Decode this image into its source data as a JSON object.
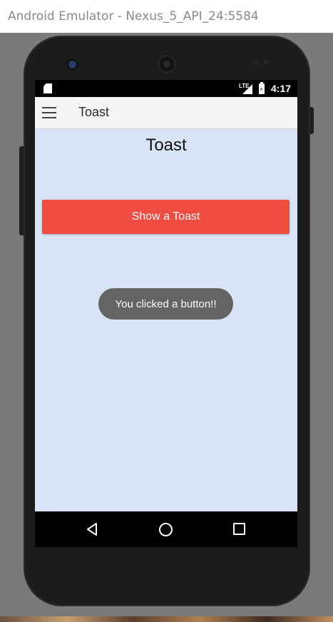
{
  "window": {
    "title": "Android Emulator - Nexus_5_API_24:5584"
  },
  "statusbar": {
    "network": "LTE",
    "time": "4:17"
  },
  "appbar": {
    "title": "Toast"
  },
  "content": {
    "heading": "Toast",
    "button_label": "Show a Toast",
    "toast_message": "You clicked a button!!"
  },
  "colors": {
    "content_bg": "#d6e4f5",
    "button_bg": "#f24b3f",
    "toast_bg": "#646464"
  },
  "icons": {
    "menu": "hamburger-icon",
    "back": "back-triangle-icon",
    "home": "home-circle-icon",
    "recent": "recent-square-icon"
  }
}
